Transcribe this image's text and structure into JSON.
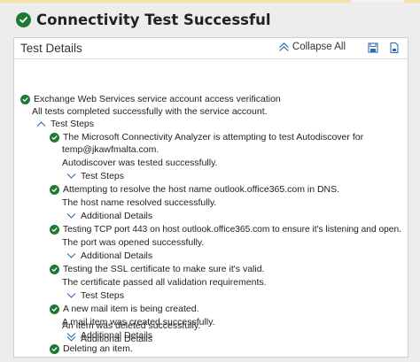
{
  "header": {
    "title": "Connectivity Test Successful"
  },
  "panel": {
    "title": "Test Details",
    "collapse_all_label": "Collapse All"
  },
  "results": {
    "root_title": "Exchange Web Services service account access verification",
    "root_status": "All tests completed successfully with the service account.",
    "root_toggle": "Test Steps",
    "steps": [
      {
        "title_line1": "The Microsoft Connectivity Analyzer is attempting to test Autodiscover for",
        "title_line2": "temp@jkawfmalta.com.",
        "status": "Autodiscover was tested successfully.",
        "toggle": "Test Steps"
      },
      {
        "title_line1": "Attempting to resolve the host name outlook.office365.com in DNS.",
        "status": "The host name resolved successfully.",
        "toggle": "Additional Details"
      },
      {
        "title_line1": "Testing TCP port 443 on host outlook.office365.com to ensure it's listening and open.",
        "status": "The port was opened successfully.",
        "toggle": "Additional Details"
      },
      {
        "title_line1": "Testing the SSL certificate to make sure it's valid.",
        "status": "The certificate passed all validation requirements.",
        "toggle": "Test Steps"
      },
      {
        "title_line1": "A new mail item is being created.",
        "status": "A mail item was created successfully.",
        "toggle": "Additional Details"
      },
      {
        "title_line1": "Deleting an item.",
        "status": "An item was deleted successfully.",
        "toggle": "Additional Details"
      }
    ]
  },
  "colors": {
    "success": "#1e7a32",
    "accent": "#2b6cb0"
  },
  "icons": {
    "header": "check-circle-icon",
    "collapse": "collapse-all-icon",
    "save": "save-icon",
    "export": "export-icon",
    "expand": "chevron-down-icon",
    "collapse_step": "chevron-up-icon"
  }
}
